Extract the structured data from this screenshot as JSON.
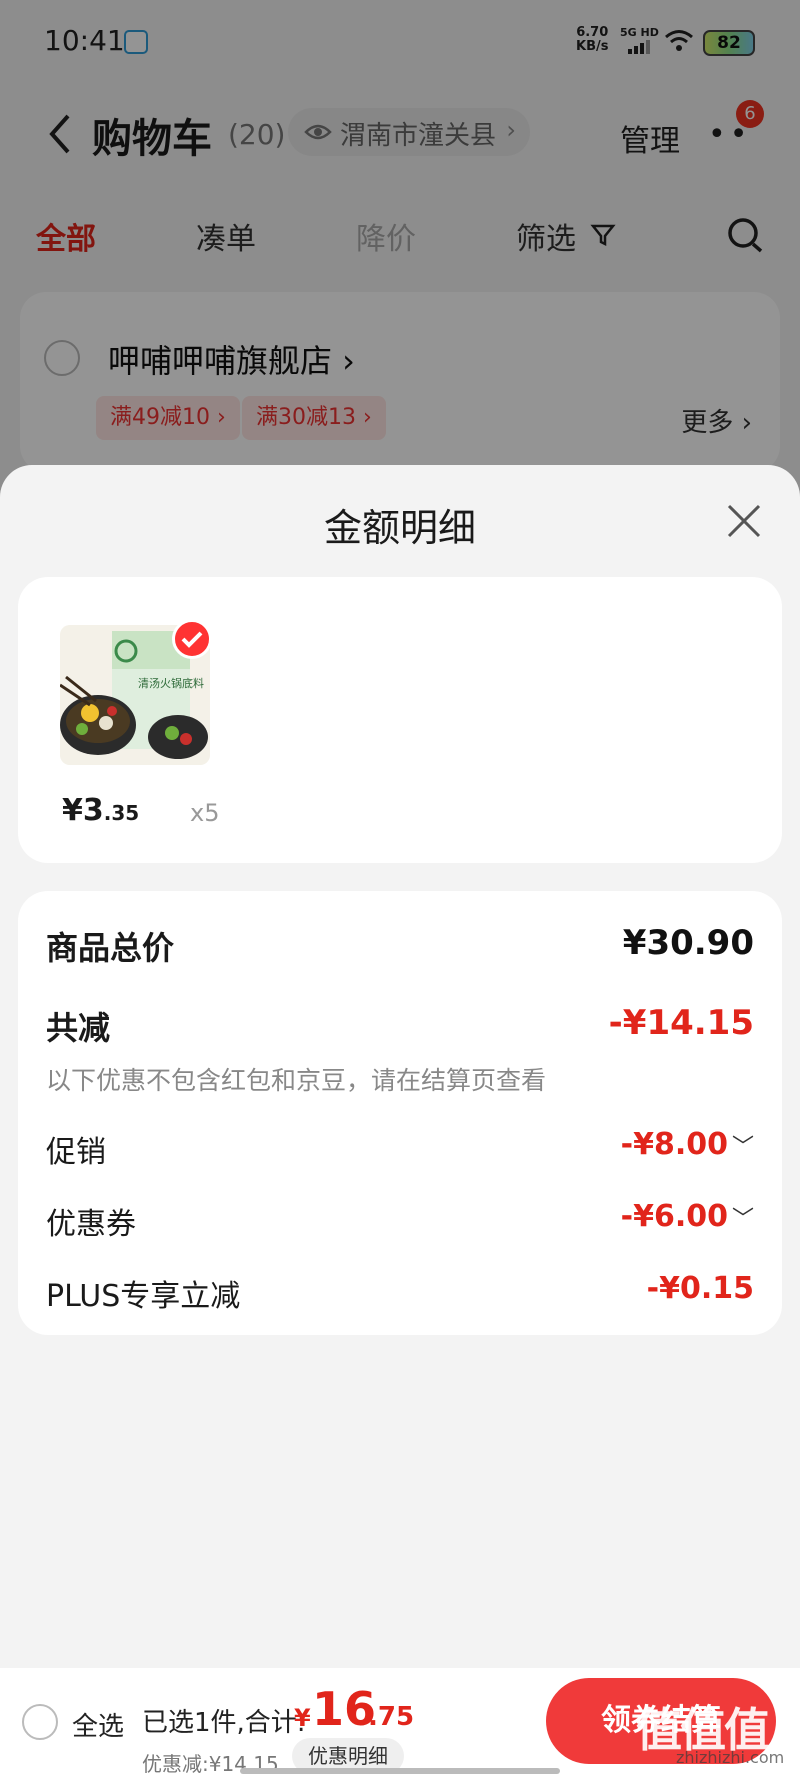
{
  "status": {
    "time": "10:41",
    "net_speed_value": "6.70",
    "net_speed_unit": "KB/s",
    "signal_label": "5G HD",
    "battery": "82"
  },
  "nav": {
    "title": "购物车",
    "count": "(20)",
    "location": "渭南市潼关县",
    "manage": "管理",
    "notification_count": "6"
  },
  "tabs": {
    "all": "全部",
    "bundle": "凑单",
    "price_drop": "降价",
    "filter": "筛选"
  },
  "store": {
    "name": "呷哺呷哺旗舰店 ›",
    "coupons": [
      "满49减10 ›",
      "满30减13 ›"
    ],
    "more": "更多 ›"
  },
  "sheet": {
    "title": "金额明细",
    "product": {
      "price_symbol_int": "¥3",
      "price_cents": ".35",
      "quantity": "x5",
      "package_text": "清汤火锅底料"
    },
    "summary": {
      "goods_total_label": "商品总价",
      "goods_total_value": "¥30.90",
      "total_reduce_label": "共减",
      "total_reduce_value": "-¥14.15",
      "note": "以下优惠不包含红包和京豆，请在结算页查看",
      "promo_label": "促销",
      "promo_value": "-¥8.00",
      "coupon_label": "优惠券",
      "coupon_value": "-¥6.00",
      "plus_label": "PLUS专享立减",
      "plus_value": "-¥0.15"
    }
  },
  "bottom": {
    "select_all": "全选",
    "selected_text": "已选1件,合计:",
    "total_symbol": "¥",
    "total_int": "16",
    "total_dec": ".75",
    "discount_text": "优惠减:¥14.15",
    "discount_detail": "优惠明细",
    "checkout": "领券结算"
  },
  "watermark": {
    "text": "值值值",
    "sub": "zhizhizhi.com"
  },
  "colors": {
    "accent_red": "#e1251b",
    "checkout_red": "#f03a3a"
  }
}
